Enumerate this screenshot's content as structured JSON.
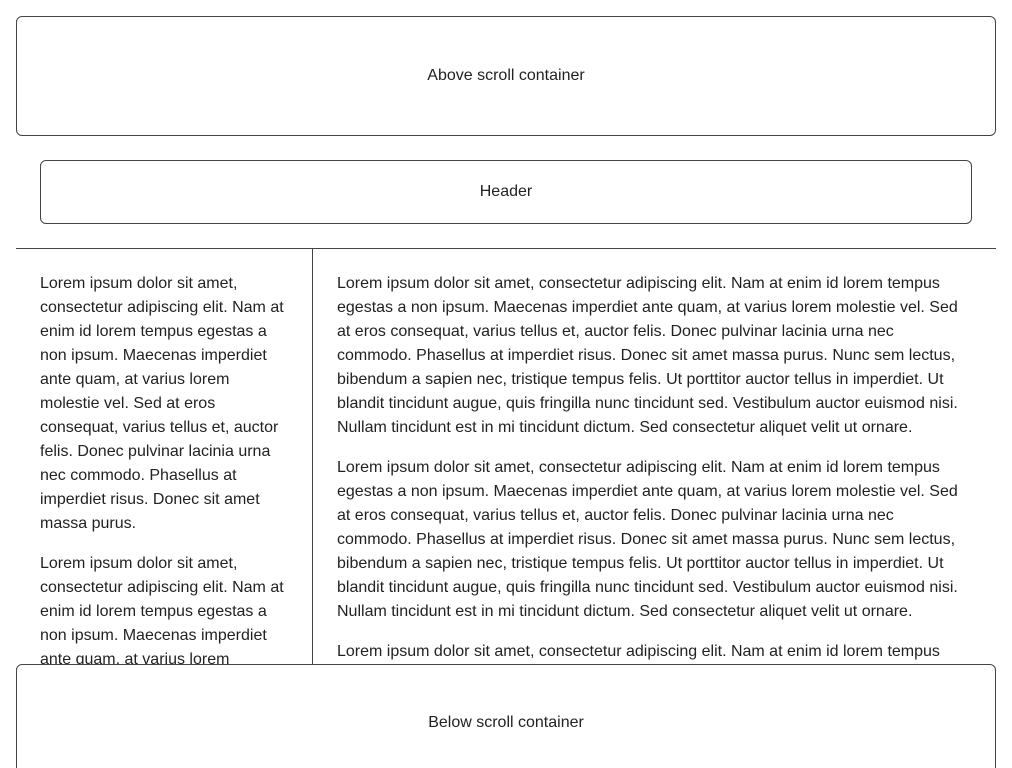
{
  "above": {
    "label": "Above scroll container"
  },
  "header": {
    "label": "Header"
  },
  "left_column": {
    "paragraphs": [
      "Lorem ipsum dolor sit amet, consectetur adipiscing elit. Nam at enim id lorem tempus egestas a non ipsum. Maecenas imperdiet ante quam, at varius lorem molestie vel. Sed at eros consequat, varius tellus et, auctor felis. Donec pulvinar lacinia urna nec commodo. Phasellus at imperdiet risus. Donec sit amet massa purus.",
      "Lorem ipsum dolor sit amet, consectetur adipiscing elit. Nam at enim id lorem tempus egestas a non ipsum. Maecenas imperdiet ante quam, at varius lorem"
    ]
  },
  "right_column": {
    "paragraphs": [
      "Lorem ipsum dolor sit amet, consectetur adipiscing elit. Nam at enim id lorem tempus egestas a non ipsum. Maecenas imperdiet ante quam, at varius lorem molestie vel. Sed at eros consequat, varius tellus et, auctor felis. Donec pulvinar lacinia urna nec commodo. Phasellus at imperdiet risus. Donec sit amet massa purus. Nunc sem lectus, bibendum a sapien nec, tristique tempus felis. Ut porttitor auctor tellus in imperdiet. Ut blandit tincidunt augue, quis fringilla nunc tincidunt sed. Vestibulum auctor euismod nisi. Nullam tincidunt est in mi tincidunt dictum. Sed consectetur aliquet velit ut ornare.",
      "Lorem ipsum dolor sit amet, consectetur adipiscing elit. Nam at enim id lorem tempus egestas a non ipsum. Maecenas imperdiet ante quam, at varius lorem molestie vel. Sed at eros consequat, varius tellus et, auctor felis. Donec pulvinar lacinia urna nec commodo. Phasellus at imperdiet risus. Donec sit amet massa purus. Nunc sem lectus, bibendum a sapien nec, tristique tempus felis. Ut porttitor auctor tellus in imperdiet. Ut blandit tincidunt augue, quis fringilla nunc tincidunt sed. Vestibulum auctor euismod nisi. Nullam tincidunt est in mi tincidunt dictum. Sed consectetur aliquet velit ut ornare.",
      "Lorem ipsum dolor sit amet, consectetur adipiscing elit. Nam at enim id lorem tempus"
    ]
  },
  "below": {
    "label": "Below scroll container"
  }
}
